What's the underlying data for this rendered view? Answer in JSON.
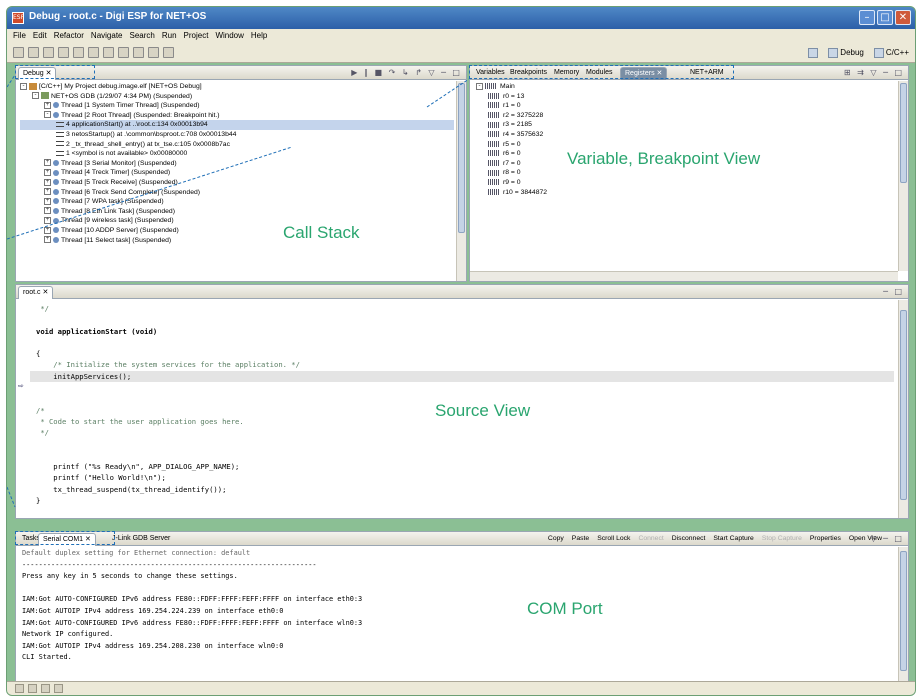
{
  "window": {
    "title": "Debug - root.c - Digi ESP for NET+OS",
    "icon_label": "ESP",
    "minimize_icon": "minimize-icon",
    "maximize_icon": "maximize-icon",
    "close_icon": "close-icon"
  },
  "menu": [
    "File",
    "Edit",
    "Refactor",
    "Navigate",
    "Search",
    "Run",
    "Project",
    "Window",
    "Help"
  ],
  "perspectives": [
    {
      "label": "Debug"
    },
    {
      "label": "C/C++"
    }
  ],
  "debug_view": {
    "tab_label": "Debug",
    "tree": [
      {
        "text": "[C/C++] My Project debug.image.elf [NET+OS Debug]",
        "level": 0,
        "toggle": "-",
        "icon": "elf"
      },
      {
        "text": "NET+OS GDB (1/29/07 4:34 PM) (Suspended)",
        "level": 1,
        "toggle": "-",
        "icon": "gdb"
      },
      {
        "text": "Thread [1 System Timer Thread] (Suspended)",
        "level": 2,
        "toggle": "+",
        "icon": "thread"
      },
      {
        "text": "Thread [2 Root Thread] (Suspended: Breakpoint hit.)",
        "level": 2,
        "toggle": "-",
        "icon": "thread"
      },
      {
        "text": "4 applicationStart() at ..\\root.c:134 0x00013b94",
        "level": 3,
        "toggle": "",
        "icon": "frame",
        "selected": true
      },
      {
        "text": "3 netosStartup() at .\\common\\bsproot.c:708 0x00013b44",
        "level": 3,
        "toggle": "",
        "icon": "frame"
      },
      {
        "text": "2 _tx_thread_shell_entry() at tx_tse.c:105 0x0008b7ac",
        "level": 3,
        "toggle": "",
        "icon": "frame"
      },
      {
        "text": "1 <symbol is not available> 0x00080000",
        "level": 3,
        "toggle": "",
        "icon": "frame"
      },
      {
        "text": "Thread [3 Serial Monitor] (Suspended)",
        "level": 2,
        "toggle": "+",
        "icon": "thread"
      },
      {
        "text": "Thread [4 Treck Timer] (Suspended)",
        "level": 2,
        "toggle": "+",
        "icon": "thread"
      },
      {
        "text": "Thread [5 Treck Receive] (Suspended)",
        "level": 2,
        "toggle": "+",
        "icon": "thread"
      },
      {
        "text": "Thread [6 Treck Send Complete] (Suspended)",
        "level": 2,
        "toggle": "+",
        "icon": "thread"
      },
      {
        "text": "Thread [7 WPA task] (Suspended)",
        "level": 2,
        "toggle": "+",
        "icon": "thread"
      },
      {
        "text": "Thread [8 Eth Link Task] (Suspended)",
        "level": 2,
        "toggle": "+",
        "icon": "thread"
      },
      {
        "text": "Thread [9 wireless task] (Suspended)",
        "level": 2,
        "toggle": "+",
        "icon": "thread"
      },
      {
        "text": "Thread [10 ADDP Server] (Suspended)",
        "level": 2,
        "toggle": "+",
        "icon": "thread"
      },
      {
        "text": "Thread [11 Select task] (Suspended)",
        "level": 2,
        "toggle": "+",
        "icon": "thread"
      }
    ]
  },
  "variables_view": {
    "tabs": [
      "Variables",
      "Breakpoints",
      "Memory",
      "Modules",
      "Registers",
      "NET+ARM"
    ],
    "active_tab": "Registers",
    "root": "Main",
    "registers": [
      "r0 = 13",
      "r1 = 0",
      "r2 = 3275228",
      "r3 = 2185",
      "r4 = 3575632",
      "r5 = 0",
      "r6 = 0",
      "r7 = 0",
      "r8 = 0",
      "r9 = 0",
      "r10 = 3844872"
    ]
  },
  "source_view": {
    "tab_label": "root.c",
    "lines": [
      {
        "text": " */",
        "style": "cm"
      },
      {
        "text": "",
        "style": ""
      },
      {
        "text": "void applicationStart (void)",
        "style": "kw"
      },
      {
        "text": "",
        "style": ""
      },
      {
        "text": "{",
        "style": ""
      },
      {
        "text": "    /* Initialize the system services for the application. */",
        "style": "cm"
      },
      {
        "text": "    initAppServices();",
        "style": "hl"
      },
      {
        "text": "",
        "style": ""
      },
      {
        "text": "",
        "style": ""
      },
      {
        "text": "/*",
        "style": "cm"
      },
      {
        "text": " * Code to start the user application goes here.",
        "style": "cm"
      },
      {
        "text": " */",
        "style": "cm"
      },
      {
        "text": "",
        "style": ""
      },
      {
        "text": "",
        "style": ""
      },
      {
        "text": "    printf (\"%s Ready\\n\", APP_DIALOG_APP_NAME);",
        "style": ""
      },
      {
        "text": "    printf (\"Hello World!\\n\");",
        "style": ""
      },
      {
        "text": "    tx_thread_suspend(tx_thread_identify());",
        "style": ""
      },
      {
        "text": "}",
        "style": ""
      }
    ]
  },
  "console_view": {
    "tabs": [
      "Tasks",
      "Serial COM1",
      "J-Link GDB Server"
    ],
    "active_tab": "Serial COM1",
    "toolbar": [
      "Copy",
      "Paste",
      "Scroll Lock",
      "Connect",
      "Disconnect",
      "Start Capture",
      "Stop Capture",
      "Properties",
      "Open View"
    ],
    "disabled": [
      "Connect",
      "Stop Capture"
    ],
    "lines": [
      "Default duplex setting for Ethernet connection: default",
      "-----------------------------------------------------------------------",
      "Press any key in 5 seconds to change these settings.",
      "",
      "IAM:Got AUTO-CONFIGURED IPv6 address FE80::FDFF:FFFF:FEFF:FFFF on interface eth0:3",
      "IAM:Got AUTOIP IPv4 address 169.254.224.239 on interface eth0:0",
      "IAM:Got AUTO-CONFIGURED IPv6 address FE80::FDFF:FFFF:FEFF:FFFF on interface wln0:3",
      "Network IP configured.",
      "IAM:Got AUTOIP IPv4 address 169.254.208.230 on interface wln0:0",
      "CLI Started."
    ]
  },
  "annotations": {
    "call_stack": "Call Stack",
    "variables": "Variable, Breakpoint View",
    "source": "Source View",
    "com_port": "COM Port"
  },
  "colors": {
    "frame": "#8bbf94",
    "annotation": "#2aa56f",
    "dashed_guide": "#1f6fb7",
    "title_bar": "#2c5fa8"
  }
}
